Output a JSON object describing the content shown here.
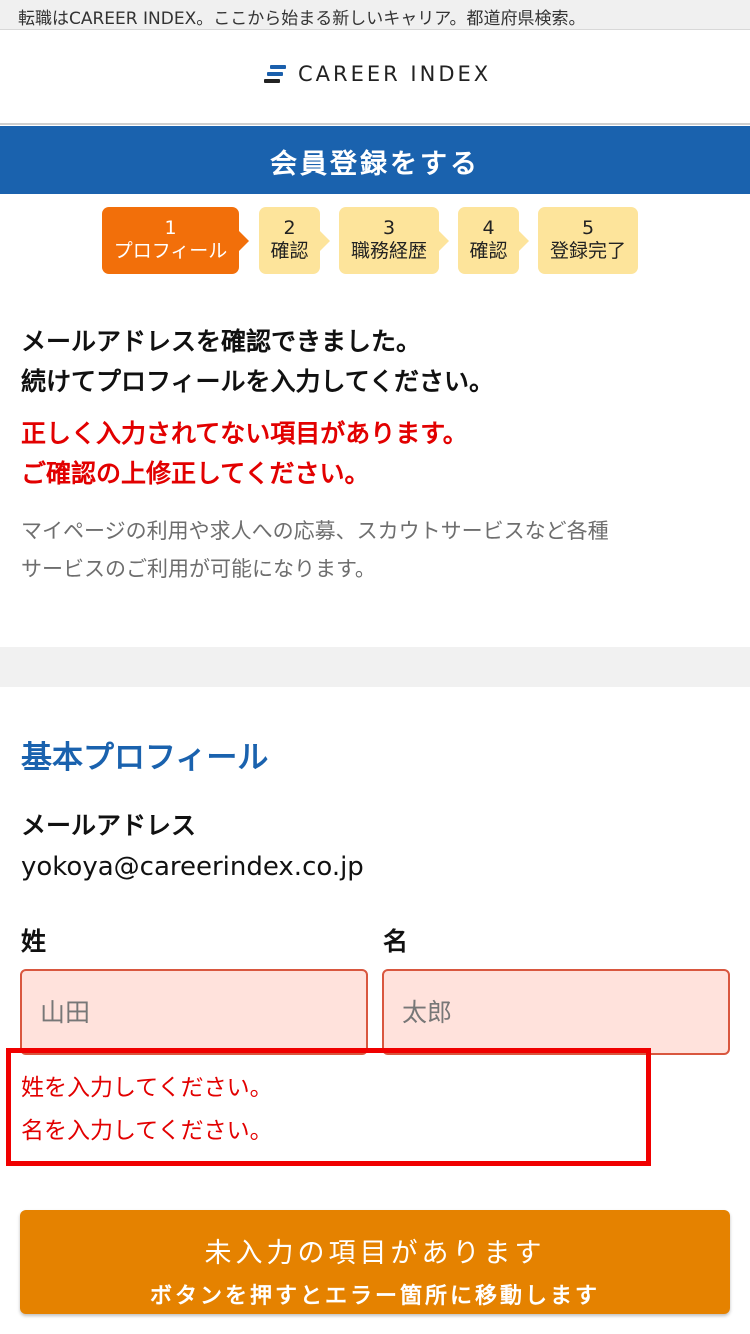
{
  "top_bar": {
    "text": "転職はCAREER INDEX。ここから始まる新しいキャリア。都道府県検索。"
  },
  "header": {
    "logo_text": "CAREER INDEX",
    "logo_icon": "stacked-bars-icon"
  },
  "page_title": "会員登録をする",
  "steps": [
    {
      "num": "1",
      "label": "プロフィール",
      "state": "active"
    },
    {
      "num": "2",
      "label": "確認",
      "state": "inactive"
    },
    {
      "num": "3",
      "label": "職務経歴",
      "state": "inactive"
    },
    {
      "num": "4",
      "label": "確認",
      "state": "inactive"
    },
    {
      "num": "5",
      "label": "登録完了",
      "state": "inactive"
    }
  ],
  "intro": {
    "line1": "メールアドレスを確認できました。",
    "line2": "続けてプロフィールを入力してください。",
    "error1": "正しく入力されてない項目があります。",
    "error2": "ご確認の上修正してください。",
    "note1": "マイページの利用や求人への応募、スカウトサービスなど各種",
    "note2": "サービスのご利用が可能になります。"
  },
  "profile": {
    "section_title": "基本プロフィール",
    "email_label": "メールアドレス",
    "email_value": "yokoya@careerindex.co.jp",
    "last_name_label": "姓",
    "first_name_label": "名",
    "last_name_placeholder": "山田",
    "first_name_placeholder": "太郎",
    "last_name_value": "",
    "first_name_value": "",
    "error_last": "姓を入力してください。",
    "error_first": "名を入力してください。"
  },
  "submit": {
    "line1": "未入力の項目があります",
    "line2": "ボタンを押すとエラー箇所に移動します"
  },
  "colors": {
    "brand_blue": "#1a62ae",
    "step_active": "#f26f0a",
    "step_inactive": "#fde49b",
    "error_red": "#e20000",
    "field_error_bg": "#ffe2dc",
    "submit_orange": "#e58200"
  }
}
